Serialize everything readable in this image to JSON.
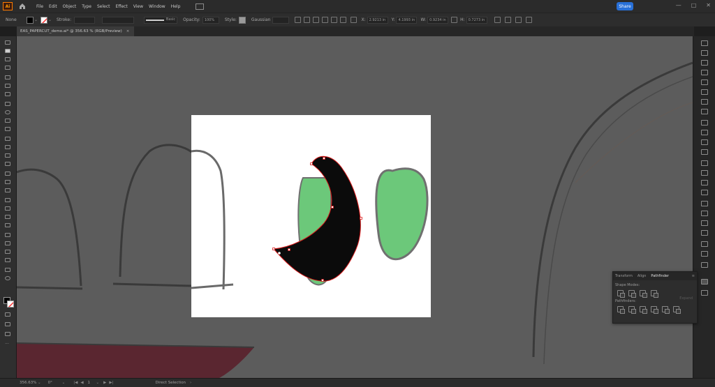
{
  "app": {
    "logo_text": "Ai",
    "menu": [
      "File",
      "Edit",
      "Object",
      "Type",
      "Select",
      "Effect",
      "View",
      "Window",
      "Help"
    ],
    "share_label": "Share"
  },
  "controlbar": {
    "selection_label": "None",
    "stroke_label": "Stroke:",
    "stroke_style": "Basic",
    "opacity_label": "Opacity:",
    "opacity_value": "100%",
    "style_label": "Style:",
    "document_setup": "Gaussian",
    "x_label": "X:",
    "x_value": "2.9213 in",
    "y_label": "Y:",
    "y_value": "4.1993 in",
    "w_label": "W:",
    "w_value": "0.9234 in",
    "h_label": "H:",
    "h_value": "0.7273 in"
  },
  "document": {
    "tab_title": "EAS_PAPERCUT_demo.ai* @ 356.63 % (RGB/Preview)",
    "close_glyph": "×"
  },
  "pathfinder": {
    "tabs": [
      "Transform",
      "Align",
      "Pathfinder"
    ],
    "active_tab": "Pathfinder",
    "shape_modes_label": "Shape Modes:",
    "pathfinders_label": "Pathfinders:",
    "expand_label": "Expand"
  },
  "statusbar": {
    "zoom": "356.63%",
    "rotation": "0°",
    "artboard_number": "1",
    "tool_name": "Direct Selection"
  },
  "colors": {
    "fill": "#000000",
    "stroke_none": "#ff3030",
    "eye_green": "#6cc87a",
    "path_highlight": "#d81b1b",
    "mouth": "#7a2a36",
    "accent": "#2870d8"
  }
}
